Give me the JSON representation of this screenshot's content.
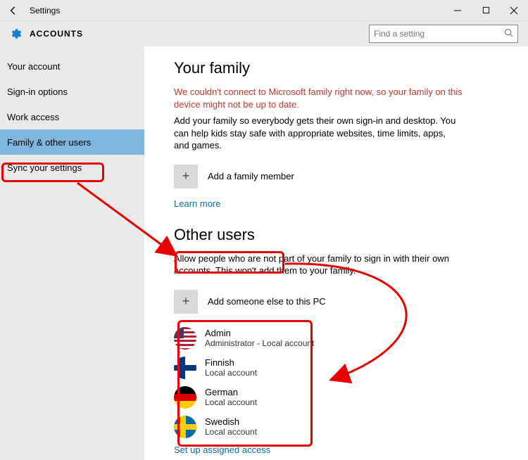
{
  "window": {
    "title": "Settings"
  },
  "header": {
    "app_name": "ACCOUNTS",
    "search_placeholder": "Find a setting"
  },
  "sidebar": {
    "items": [
      {
        "label": "Your account"
      },
      {
        "label": "Sign-in options"
      },
      {
        "label": "Work access"
      },
      {
        "label": "Family & other users"
      },
      {
        "label": "Sync your settings"
      }
    ],
    "selected_index": 3
  },
  "family": {
    "heading": "Your family",
    "warning": "We couldn't connect to Microsoft family right now, so your family on this device might not be up to date.",
    "description": "Add your family so everybody gets their own sign-in and desktop. You can help kids stay safe with appropriate websites, time limits, apps, and games.",
    "add_label": "Add a family member",
    "learn_more": "Learn more"
  },
  "other_users": {
    "heading": "Other users",
    "description": "Allow people who are not part of your family to sign in with their own accounts. This won't add them to your family.",
    "add_label": "Add someone else to this PC",
    "users": [
      {
        "name": "Admin",
        "subtitle": "Administrator - Local account",
        "flag": "us"
      },
      {
        "name": "Finnish",
        "subtitle": "Local account",
        "flag": "fi"
      },
      {
        "name": "German",
        "subtitle": "Local account",
        "flag": "de"
      },
      {
        "name": "Swedish",
        "subtitle": "Local account",
        "flag": "se"
      }
    ],
    "assigned_access": "Set up assigned access"
  }
}
